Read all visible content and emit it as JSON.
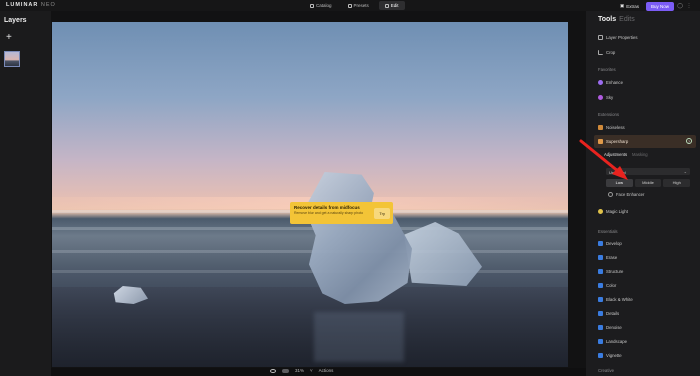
{
  "app": {
    "logo_main": "LUMINAR",
    "logo_sub": "NEO"
  },
  "nav": {
    "catalog": "Catalog",
    "presets": "Presets",
    "edit": "Edit"
  },
  "top_right": {
    "extras": "Extras",
    "buy_now": "Buy Now"
  },
  "layers": {
    "title": "Layers",
    "add_symbol": "+"
  },
  "tooltip": {
    "title": "Recover details from midfocus",
    "body": "Remove blur and get a naturally sharp photo",
    "button": "Try"
  },
  "bottombar": {
    "zoom": "31%",
    "actions": "Actions"
  },
  "tools": {
    "title": "Tools",
    "edits_tab": "Edits",
    "layer_properties": "Layer Properties",
    "crop": "Crop",
    "favorites_section": "Favorites",
    "enhance_ai": "Enhance",
    "sky_ai": "Sky",
    "extensions_section": "Extensions",
    "noiseless_ai": "Noiseless",
    "supersharp_ai": "Supersharp",
    "adjustments_tab": "Adjustments",
    "masking_tab": "Masking",
    "mode_select": "Universal",
    "seg_low": "Low",
    "seg_middle": "Middle",
    "seg_high": "High",
    "face_enhancer": "Face Enhancer",
    "magic_light_ai": "Magic Light",
    "essentials_section": "Essentials",
    "develop": "Develop",
    "erase": "Erase",
    "structure_ai": "Structure",
    "color": "Color",
    "black_white": "Black & White",
    "details": "Details",
    "denoise": "Denoise",
    "landscape": "Landscape",
    "vignette": "Vignette",
    "creative_section": "Creative"
  },
  "colors": {
    "accent": "#7b5cf5",
    "tooltip": "#f3c437",
    "arrow": "#e8231f"
  }
}
